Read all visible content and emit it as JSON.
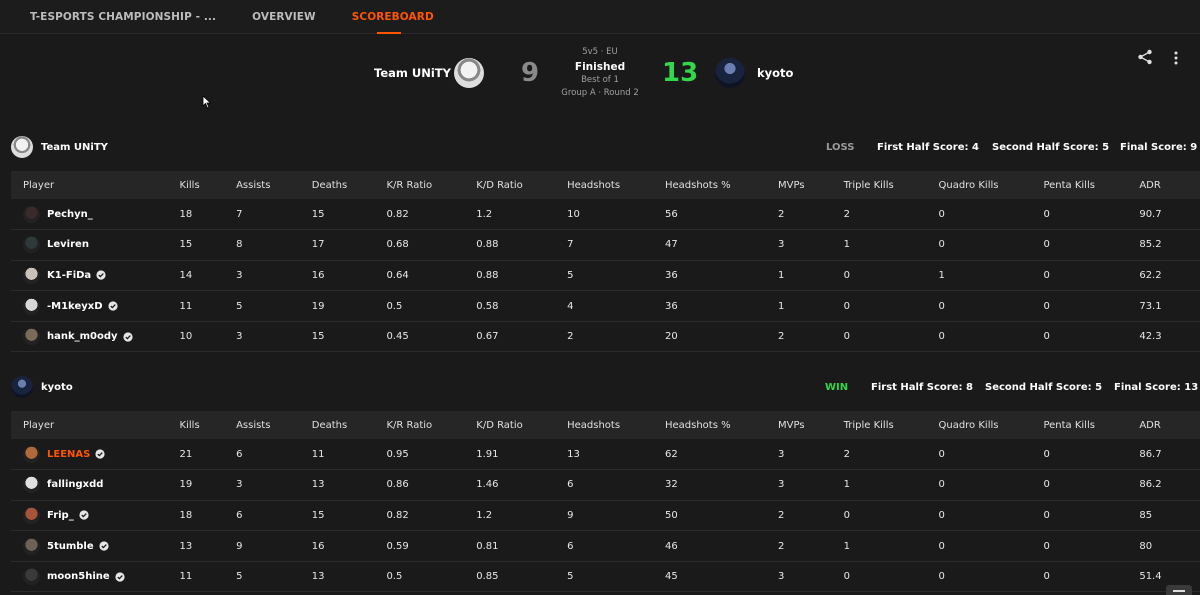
{
  "nav": {
    "tabs": [
      {
        "label": "T-ESPORTS CHAMPIONSHIP - ..."
      },
      {
        "label": "OVERVIEW"
      },
      {
        "label": "SCOREBOARD"
      }
    ]
  },
  "match": {
    "left_team": "Team UNiTY",
    "right_team": "kyoto",
    "left_score": "9",
    "right_score": "13",
    "format": "5v5 · EU",
    "status": "Finished",
    "best_of": "Best of 1",
    "round": "Group A · Round 2"
  },
  "columns": [
    "Player",
    "Kills",
    "Assists",
    "Deaths",
    "K/R Ratio",
    "K/D Ratio",
    "Headshots",
    "Headshots %",
    "MVPs",
    "Triple Kills",
    "Quadro Kills",
    "Penta Kills",
    "ADR"
  ],
  "teams": [
    {
      "name": "Team UNiTY",
      "result": "LOSS",
      "first_half": "First Half Score: 4",
      "second_half": "Second Half Score: 5",
      "final": "Final Score: 9",
      "players": [
        {
          "name": "Pechyn_",
          "verified": false,
          "highlight": false,
          "avatar_color": "#3a2a2a",
          "stats": [
            "18",
            "7",
            "15",
            "0.82",
            "1.2",
            "10",
            "56",
            "2",
            "2",
            "0",
            "0",
            "90.7"
          ]
        },
        {
          "name": "Leviren",
          "verified": false,
          "highlight": false,
          "avatar_color": "#2e3a3a",
          "stats": [
            "15",
            "8",
            "17",
            "0.68",
            "0.88",
            "7",
            "47",
            "3",
            "1",
            "0",
            "0",
            "85.2"
          ]
        },
        {
          "name": "K1-FiDa",
          "verified": true,
          "highlight": false,
          "avatar_color": "#c9c2b8",
          "stats": [
            "14",
            "3",
            "16",
            "0.64",
            "0.88",
            "5",
            "36",
            "1",
            "0",
            "1",
            "0",
            "62.2"
          ]
        },
        {
          "name": "-M1keyxD",
          "verified": true,
          "highlight": false,
          "avatar_color": "#d8d8d8",
          "stats": [
            "11",
            "5",
            "19",
            "0.5",
            "0.58",
            "4",
            "36",
            "1",
            "0",
            "0",
            "0",
            "73.1"
          ]
        },
        {
          "name": "hank_m0ody",
          "verified": true,
          "highlight": false,
          "avatar_color": "#7a6a58",
          "stats": [
            "10",
            "3",
            "15",
            "0.45",
            "0.67",
            "2",
            "20",
            "2",
            "0",
            "0",
            "0",
            "42.3"
          ]
        }
      ]
    },
    {
      "name": "kyoto",
      "result": "WIN",
      "first_half": "First Half Score: 8",
      "second_half": "Second Half Score: 5",
      "final": "Final Score: 13",
      "players": [
        {
          "name": "LEENAS",
          "verified": true,
          "highlight": true,
          "avatar_color": "#b06a3a",
          "stats": [
            "21",
            "6",
            "11",
            "0.95",
            "1.91",
            "13",
            "62",
            "3",
            "2",
            "0",
            "0",
            "86.7"
          ]
        },
        {
          "name": "fallingxdd",
          "verified": false,
          "highlight": false,
          "avatar_color": "#e0e0e0",
          "stats": [
            "19",
            "3",
            "13",
            "0.86",
            "1.46",
            "6",
            "32",
            "3",
            "1",
            "0",
            "0",
            "86.2"
          ]
        },
        {
          "name": "Frip_",
          "verified": true,
          "highlight": false,
          "avatar_color": "#a8543a",
          "stats": [
            "18",
            "6",
            "15",
            "0.82",
            "1.2",
            "9",
            "50",
            "2",
            "0",
            "0",
            "0",
            "85"
          ]
        },
        {
          "name": "5tumble",
          "verified": true,
          "highlight": false,
          "avatar_color": "#6e6257",
          "stats": [
            "13",
            "9",
            "16",
            "0.59",
            "0.81",
            "6",
            "46",
            "2",
            "1",
            "0",
            "0",
            "80"
          ]
        },
        {
          "name": "moon5hine",
          "verified": true,
          "highlight": false,
          "avatar_color": "#3a3a3a",
          "stats": [
            "11",
            "5",
            "13",
            "0.5",
            "0.85",
            "5",
            "45",
            "3",
            "0",
            "0",
            "0",
            "51.4"
          ]
        }
      ]
    }
  ],
  "icons": {
    "share": "share-icon",
    "more": "more-vertical-icon",
    "verified": "verified-badge-icon",
    "cursor": "mouse-cursor-icon"
  },
  "colors": {
    "accent": "#ff5500",
    "win": "#32d74b",
    "loss": "#9a9a9a"
  }
}
